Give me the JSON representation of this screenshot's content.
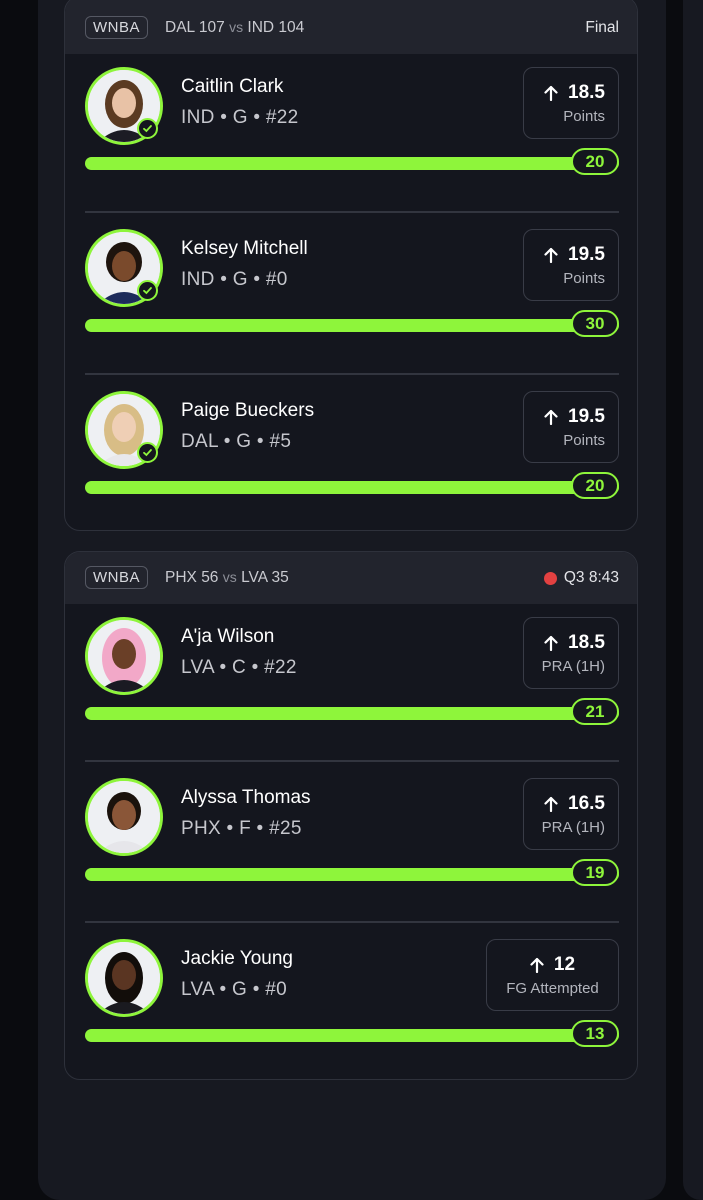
{
  "colors": {
    "accent": "#8ef53b",
    "live": "#e34141",
    "background": "#14161e"
  },
  "games": [
    {
      "league": "WNBA",
      "team1": "DAL",
      "score1": "107",
      "vs": "vs",
      "team2": "IND",
      "score2": "104",
      "status": "Final",
      "players": [
        {
          "name": "Caitlin Clark",
          "meta": "IND • G • #22",
          "line": "18.5",
          "stat": "Points",
          "actual": "20",
          "progress": 1.0,
          "icon": "arrow-up-icon",
          "hit": true
        },
        {
          "name": "Kelsey Mitchell",
          "meta": "IND • G • #0",
          "line": "19.5",
          "stat": "Points",
          "actual": "30",
          "progress": 1.0,
          "icon": "arrow-up-icon",
          "hit": true
        },
        {
          "name": "Paige Bueckers",
          "meta": "DAL • G • #5",
          "line": "19.5",
          "stat": "Points",
          "actual": "20",
          "progress": 1.0,
          "icon": "arrow-up-icon",
          "hit": true
        }
      ]
    },
    {
      "league": "WNBA",
      "team1": "PHX",
      "score1": "56",
      "vs": "vs",
      "team2": "LVA",
      "score2": "35",
      "status": "Q3 8:43",
      "players": [
        {
          "name": "A'ja Wilson",
          "meta": "LVA • C • #22",
          "line": "18.5",
          "stat": "PRA (1H)",
          "actual": "21",
          "progress": 1.0,
          "icon": "arrow-up-icon",
          "hit": false
        },
        {
          "name": "Alyssa Thomas",
          "meta": "PHX • F • #25",
          "line": "16.5",
          "stat": "PRA (1H)",
          "actual": "19",
          "progress": 1.0,
          "icon": "arrow-up-icon",
          "hit": false
        },
        {
          "name": "Jackie Young",
          "meta": "LVA • G • #0",
          "line": "12",
          "stat": "FG Attempted",
          "actual": "13",
          "progress": 1.0,
          "icon": "arrow-up-icon",
          "hit": false
        }
      ]
    }
  ]
}
